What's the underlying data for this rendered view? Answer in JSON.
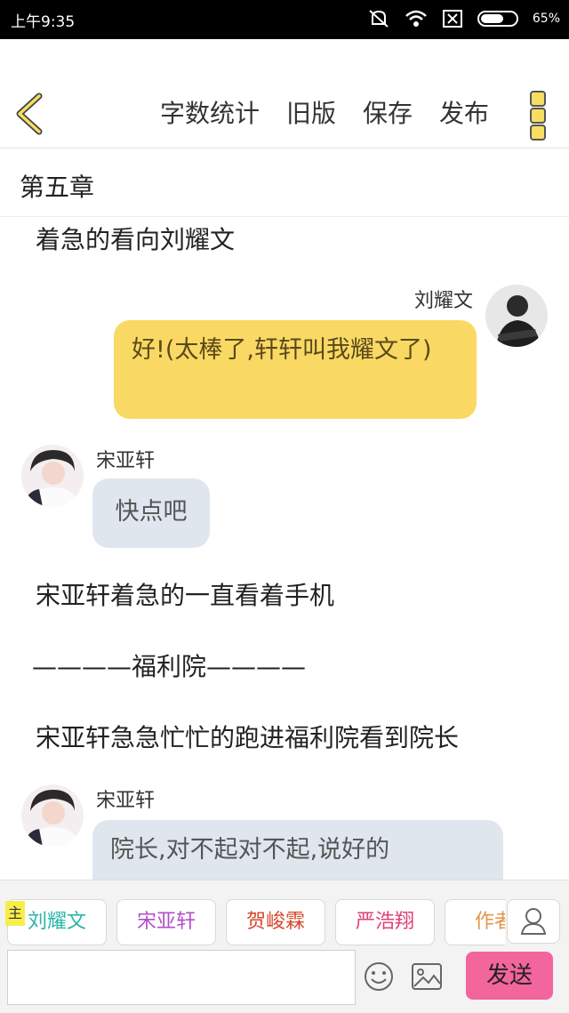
{
  "status": {
    "time": "上午9:35",
    "battery_percent": "65%",
    "battery_level": 0.65
  },
  "toolbar": {
    "actions": [
      "字数统计",
      "旧版",
      "保存",
      "发布"
    ]
  },
  "chapter": {
    "title": "第五章"
  },
  "story": {
    "narr1": "着急的看向刘耀文",
    "msg1": {
      "name": "刘耀文",
      "text": "好!(太棒了,轩轩叫我耀文了)"
    },
    "msg2": {
      "name": "宋亚轩",
      "text": "快点吧"
    },
    "narr2": "宋亚轩着急的一直看着手机",
    "divider": "————福利院————",
    "narr3": "宋亚轩急急忙忙的跑进福利院看到院长",
    "msg3": {
      "name": "宋亚轩",
      "text": "院长,对不起对不起,说好的"
    }
  },
  "bottom": {
    "main_tag": "主",
    "chips": [
      {
        "label": "刘耀文",
        "color": "#2bb5a8"
      },
      {
        "label": "宋亚轩",
        "color": "#b44ec9"
      },
      {
        "label": "贺峻霖",
        "color": "#d9472b"
      },
      {
        "label": "严浩翔",
        "color": "#e0407a"
      },
      {
        "label": "作者",
        "color": "#e6944a"
      }
    ],
    "input_placeholder": "",
    "send_label": "发送"
  }
}
